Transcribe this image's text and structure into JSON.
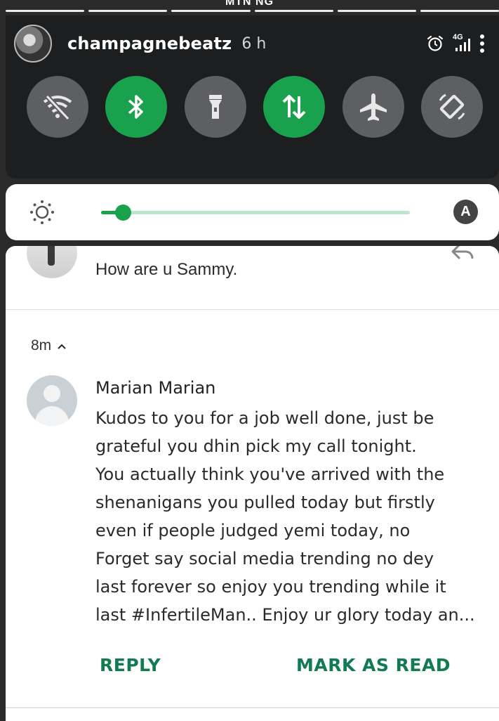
{
  "status_bar": {
    "carrier": "MTN NG"
  },
  "story": {
    "segments": 6
  },
  "quick_settings": {
    "username": "champagnebeatz",
    "time_ago": "6 h",
    "network": "4G",
    "tiles": [
      {
        "icon": "wifi-off-icon",
        "state": "off"
      },
      {
        "icon": "bluetooth-icon",
        "state": "on"
      },
      {
        "icon": "flashlight-icon",
        "state": "off"
      },
      {
        "icon": "mobile-data-icon",
        "state": "on"
      },
      {
        "icon": "airplane-mode-icon",
        "state": "off"
      },
      {
        "icon": "auto-rotate-icon",
        "state": "off"
      }
    ]
  },
  "brightness": {
    "level": 0.07,
    "auto_label": "A"
  },
  "notifications": {
    "previous": {
      "text": "How are u Sammy."
    },
    "group_time": "8m",
    "message": {
      "sender": "Marian Marian",
      "lines": [
        "Kudos to you for a job well done, just be",
        "grateful you dhin pick my call tonight.",
        "You actually think you've arrived with the",
        "shenanigans you pulled today but firstly",
        "even if people judged yemi today, no",
        "Forget say social media trending no dey",
        "last forever so enjoy you trending while it",
        "last #InfertileMan.. Enjoy ur glory today an..."
      ]
    },
    "actions": {
      "reply": "REPLY",
      "mark_read": "MARK AS READ"
    }
  },
  "colors": {
    "accent": "#1aa14d",
    "action_text": "#137b52",
    "tile_off": "#5d5f62"
  }
}
